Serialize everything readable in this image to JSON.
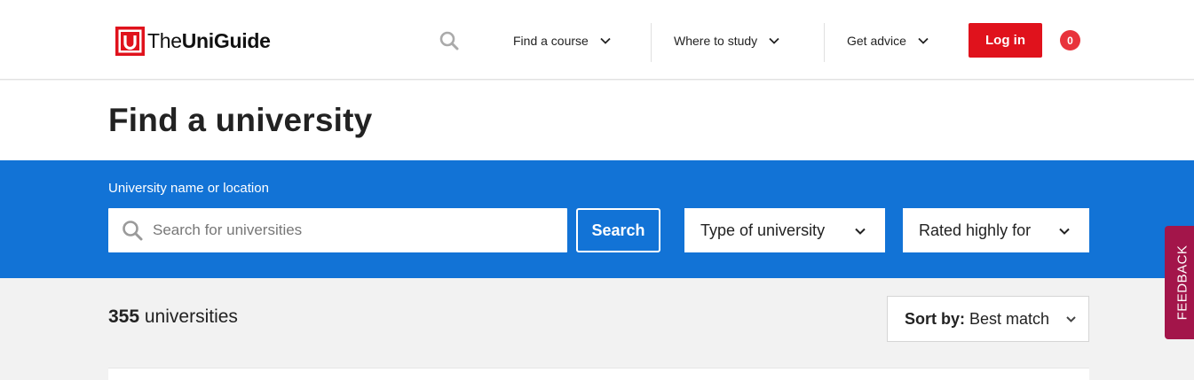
{
  "header": {
    "logo": {
      "prefix": "The",
      "bold": "UniGuide",
      "mark_letter": "U"
    },
    "nav": [
      {
        "label": "Find a course"
      },
      {
        "label": "Where to study"
      },
      {
        "label": "Get advice"
      }
    ],
    "login_label": "Log in",
    "cart_count": "0"
  },
  "page": {
    "title": "Find a university"
  },
  "search": {
    "label": "University name or location",
    "placeholder": "Search for universities",
    "value": "",
    "button_label": "Search",
    "filters": [
      {
        "label": "Type of university"
      },
      {
        "label": "Rated highly for"
      }
    ]
  },
  "results": {
    "count": "355",
    "count_suffix": " universities",
    "sort_label": "Sort by:",
    "sort_value": "Best match"
  },
  "feedback_label": "FEEDBACK",
  "colors": {
    "brand_red": "#e0121c",
    "band_blue": "#1273d6",
    "feedback": "#a3154a"
  }
}
